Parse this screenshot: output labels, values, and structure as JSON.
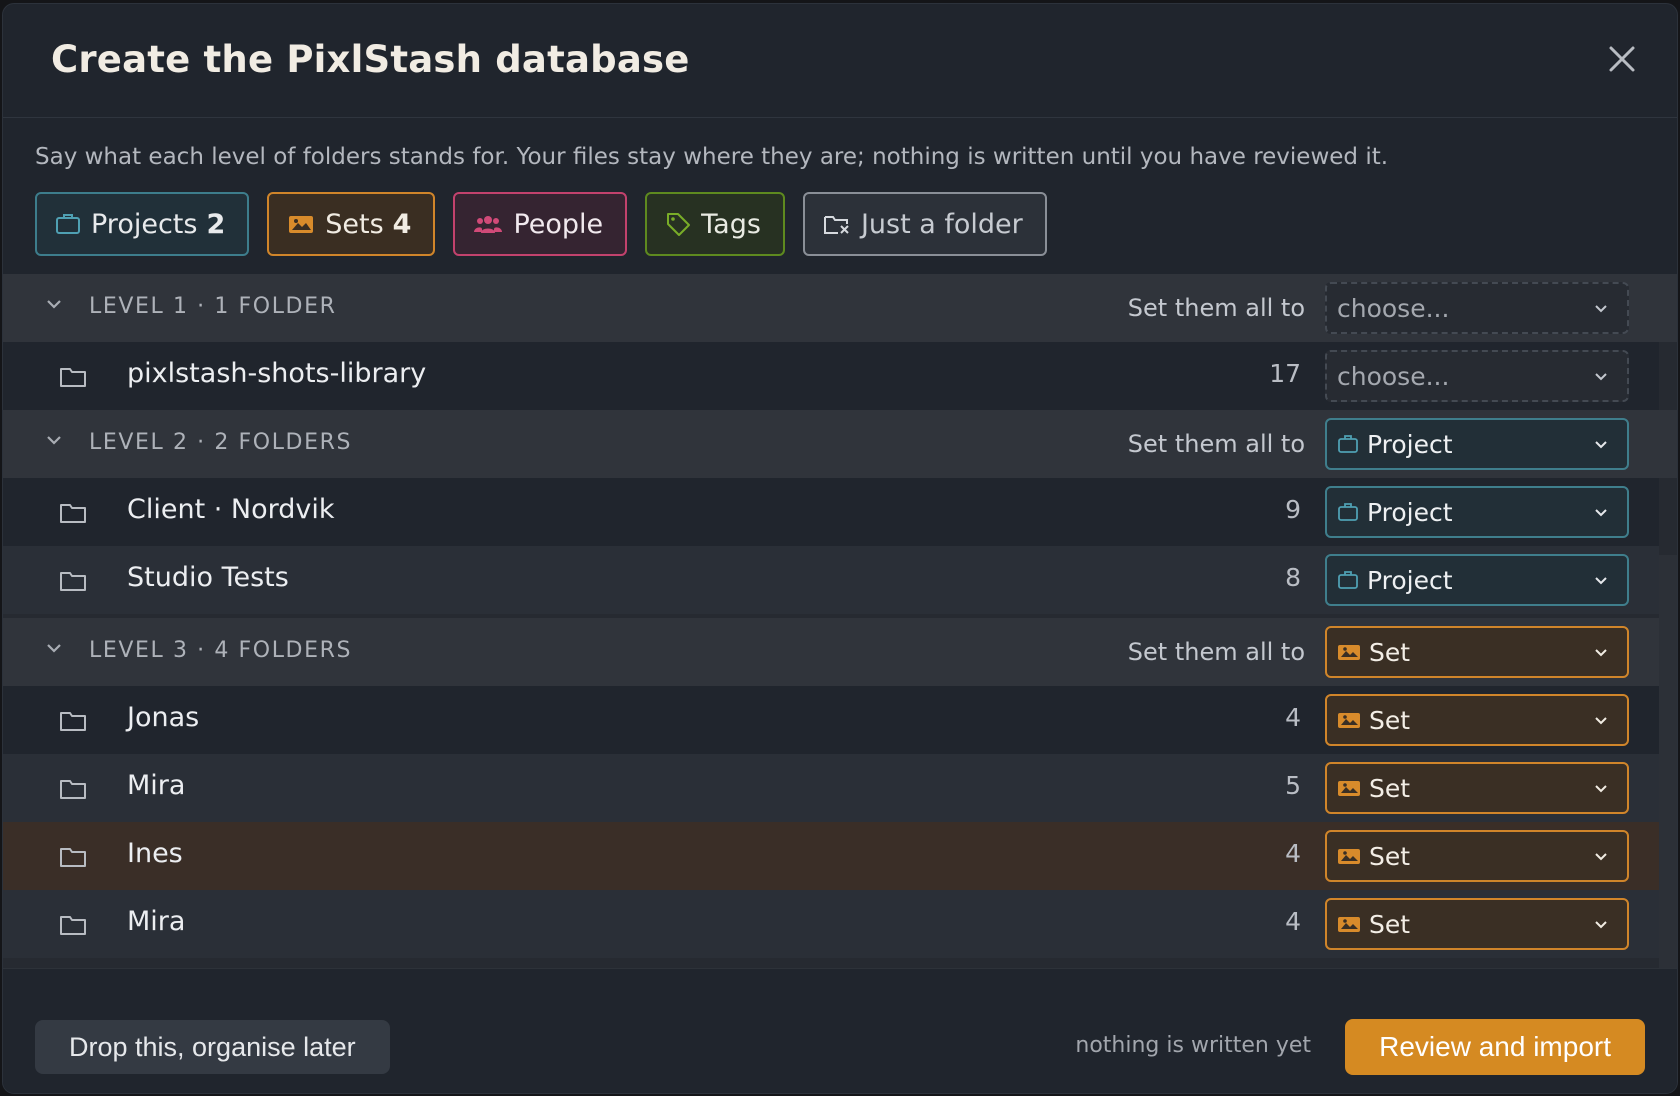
{
  "dialog": {
    "title": "Create the PixlStash database",
    "close_icon": "close-icon",
    "intro": "Say what each level of folders stands for. Your files stay where they are; nothing is written until you have reviewed it."
  },
  "chips": [
    {
      "label": "Projects",
      "count": "2",
      "icon": "briefcase-icon",
      "color": "#3d7d8c"
    },
    {
      "label": "Sets",
      "count": "4",
      "icon": "images-icon",
      "color": "#d0852a"
    },
    {
      "label": "People",
      "count": "",
      "icon": "people-icon",
      "color": "#c2426d"
    },
    {
      "label": "Tags",
      "count": "",
      "icon": "tag-icon",
      "color": "#5e8a1f"
    },
    {
      "label": "Just a folder",
      "count": "",
      "icon": "folder-x-icon",
      "color": "#8a8f97"
    }
  ],
  "levels": [
    {
      "label": "LEVEL 1 · 1 FOLDER",
      "set_all_label": "Set them all to",
      "set_all_value": "choose...",
      "folders": [
        {
          "name": "pixlstash-shots-library",
          "count": "17",
          "value": "choose..."
        }
      ]
    },
    {
      "label": "LEVEL 2 · 2 FOLDERS",
      "set_all_label": "Set them all to",
      "set_all_value": "Project",
      "folders": [
        {
          "name": "Client · Nordvik",
          "count": "9",
          "value": "Project"
        },
        {
          "name": "Studio Tests",
          "count": "8",
          "value": "Project"
        }
      ]
    },
    {
      "label": "LEVEL 3 · 4 FOLDERS",
      "set_all_label": "Set them all to",
      "set_all_value": "Set",
      "folders": [
        {
          "name": "Jonas",
          "count": "4",
          "value": "Set"
        },
        {
          "name": "Mira",
          "count": "5",
          "value": "Set"
        },
        {
          "name": "Ines",
          "count": "4",
          "value": "Set"
        },
        {
          "name": "Mira",
          "count": "4",
          "value": "Set"
        }
      ]
    }
  ],
  "footer": {
    "later_label": "Drop this, organise later",
    "note": "nothing is written yet",
    "review_label": "Review and import",
    "accent": "#d58a22"
  }
}
